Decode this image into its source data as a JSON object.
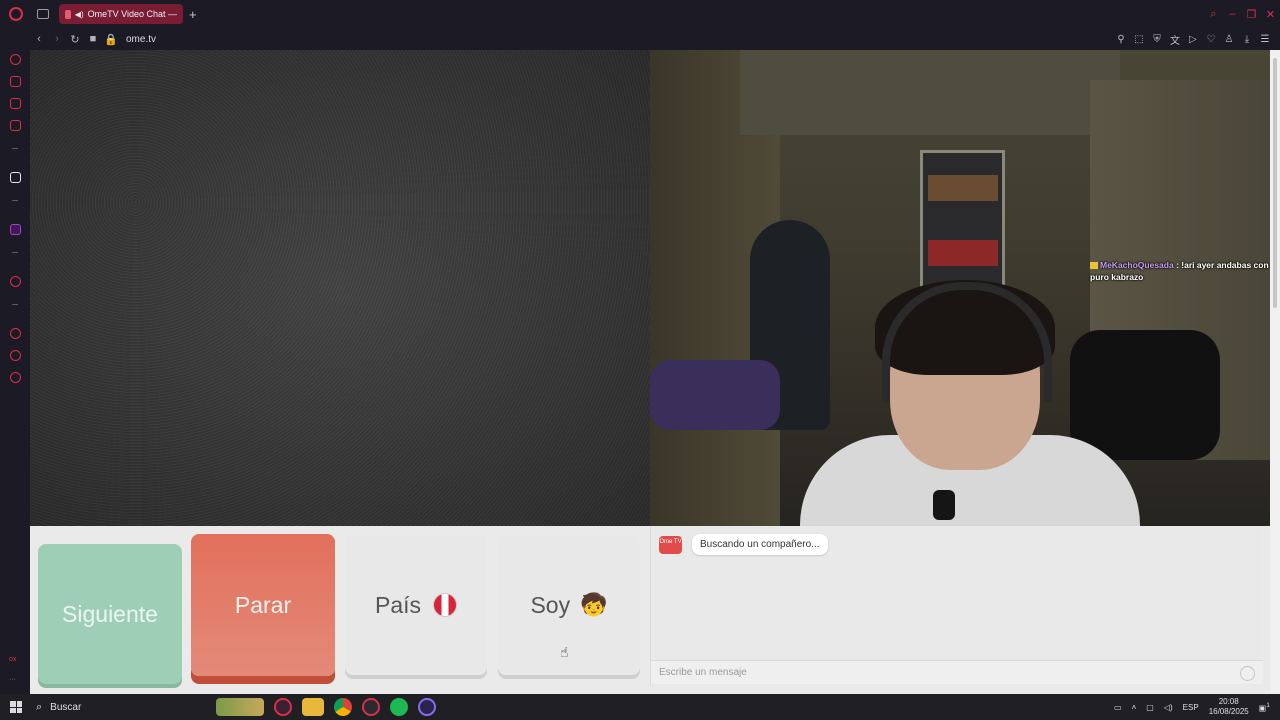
{
  "browser": {
    "tab_title": "OmeTV Video Chat —",
    "new_tab_symbol": "+",
    "address": "ome.tv",
    "sidebar_bottom_text": "ox",
    "sidebar_more": "···"
  },
  "overlay_chat": {
    "username": "MeKachoQuesada",
    "message": " : !ari ayer andabas con puro kabrazo"
  },
  "controls": {
    "next_label": "Siguiente",
    "stop_label": "Parar",
    "country_label": "País",
    "gender_label": "Soy",
    "gender_emoji": "🧒"
  },
  "chat": {
    "logo_text": "Ome TV",
    "status": "Buscando un compañero...",
    "input_placeholder": "Escribe un mensaje"
  },
  "colors": {
    "next": "#9ecfb6",
    "stop": "#e2705c",
    "accent": "#d9304a"
  },
  "taskbar": {
    "search_label": "Buscar",
    "language": "ESP",
    "time": "20:08",
    "date": "16/08/2025",
    "notification_count": "1"
  }
}
